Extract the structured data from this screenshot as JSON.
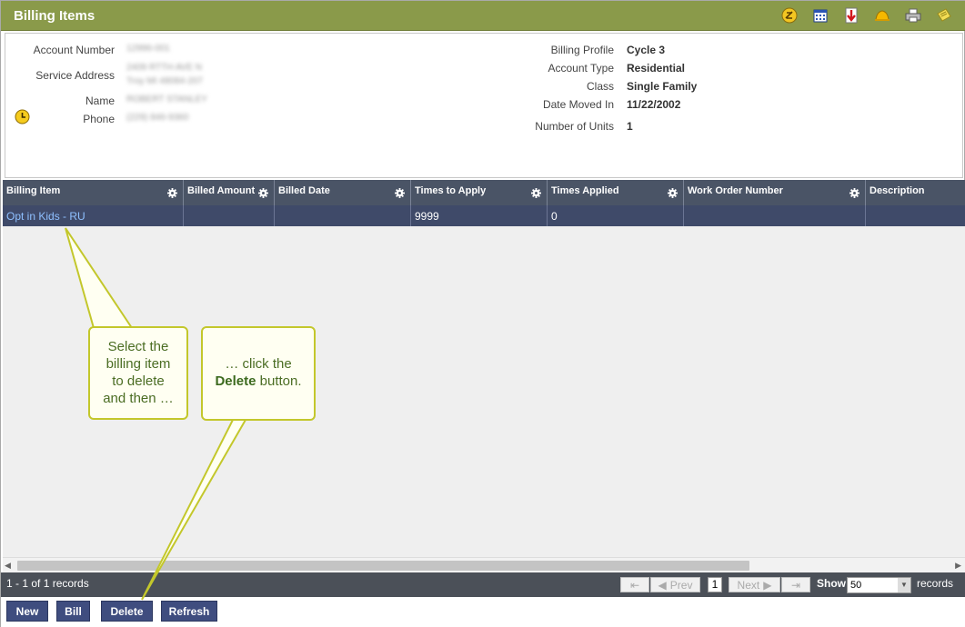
{
  "window": {
    "title": "Billing Items",
    "toolbar_icons": [
      "notes-icon",
      "calendar-icon",
      "export-icon",
      "alert-bell-icon",
      "print-icon",
      "sticky-note-icon"
    ]
  },
  "account": {
    "left_labels": {
      "account_number": "Account Number",
      "service_address": "Service Address",
      "name": "Name",
      "phone": "Phone"
    },
    "right_labels": {
      "billing_profile": "Billing Profile",
      "account_type": "Account Type",
      "class": "Class",
      "date_moved_in": "Date Moved In",
      "number_of_units": "Number of Units"
    },
    "right_values": {
      "billing_profile": "Cycle 3",
      "account_type": "Residential",
      "class": "Single Family",
      "date_moved_in": "11/22/2002",
      "number_of_units": "1"
    }
  },
  "grid": {
    "columns": [
      "Billing Item",
      "Billed Amount",
      "Billed Date",
      "Times to Apply",
      "Times Applied",
      "Work Order Number",
      "Description"
    ],
    "rows": [
      {
        "billing_item": "Opt in Kids - RU",
        "billed_amount": "",
        "billed_date": "",
        "times_to_apply": "9999",
        "times_applied": "0",
        "work_order_number": "",
        "description": ""
      }
    ]
  },
  "pager": {
    "record_summary": "1 - 1 of 1 records",
    "prev_label": "Prev",
    "next_label": "Next",
    "current_page": "1",
    "show_label": "Show",
    "page_size": "50",
    "records_label": "records"
  },
  "actions": {
    "new_label": "New",
    "bill_label": "Bill",
    "delete_label": "Delete",
    "refresh_label": "Refresh"
  },
  "callouts": {
    "first": [
      "Select the",
      "billing item",
      "to delete",
      "and then …"
    ],
    "second_line1": "… click the",
    "second_bold": "Delete",
    "second_rest": " button."
  },
  "colors": {
    "title_bar": "#8a9a4a",
    "grid_header": "#4a5466",
    "selected_row": "#3f4a69",
    "action_button": "#3f4d7f",
    "callout_border": "#c3c72b"
  }
}
